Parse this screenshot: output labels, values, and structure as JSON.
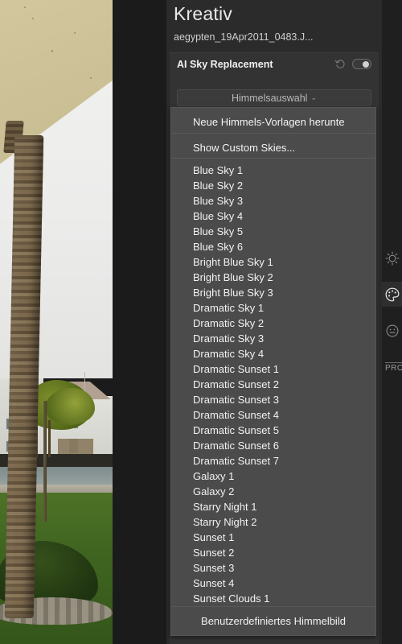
{
  "panel": {
    "title": "Kreativ",
    "filename": "aegypten_19Apr2011_0483.J...",
    "module_title": "AI Sky Replacement",
    "reset_icon": "reset-icon",
    "toggle_icon": "toggle-switch-on",
    "sky_select_label": "Himmelsauswahl",
    "sky_select_chevron": "⌄"
  },
  "dropdown": {
    "download_item": "Neue Himmels-Vorlagen herunte",
    "show_custom_item": "Show Custom Skies...",
    "items": [
      "Blue Sky 1",
      "Blue Sky 2",
      "Blue Sky 3",
      "Blue Sky 4",
      "Blue Sky 5",
      "Blue Sky 6",
      "Bright Blue Sky 1",
      "Bright Blue Sky 2",
      "Bright Blue Sky 3",
      "Dramatic Sky 1",
      "Dramatic Sky 2",
      "Dramatic Sky 3",
      "Dramatic Sky 4",
      "Dramatic Sunset 1",
      "Dramatic Sunset 2",
      "Dramatic Sunset 3",
      "Dramatic Sunset 4",
      "Dramatic Sunset 5",
      "Dramatic Sunset 6",
      "Dramatic Sunset 7",
      "Galaxy 1",
      "Galaxy 2",
      "Starry Night 1",
      "Starry Night 2",
      "Sunset 1",
      "Sunset 2",
      "Sunset 3",
      "Sunset 4",
      "Sunset Clouds 1"
    ],
    "footer_item": "Benutzerdefiniertes Himmelbild"
  },
  "rail": {
    "items": [
      {
        "name": "brightness-icon",
        "active": false
      },
      {
        "name": "color-palette-icon",
        "active": true
      },
      {
        "name": "portrait-face-icon",
        "active": false
      }
    ],
    "pro_label": "PRO"
  },
  "colors": {
    "panel_bg": "#2b2b2b",
    "module_bg": "#333333",
    "dropdown_bg": "#4b4b4b",
    "canvas_bg": "#1b1b1b",
    "text": "#f2f2f2"
  }
}
